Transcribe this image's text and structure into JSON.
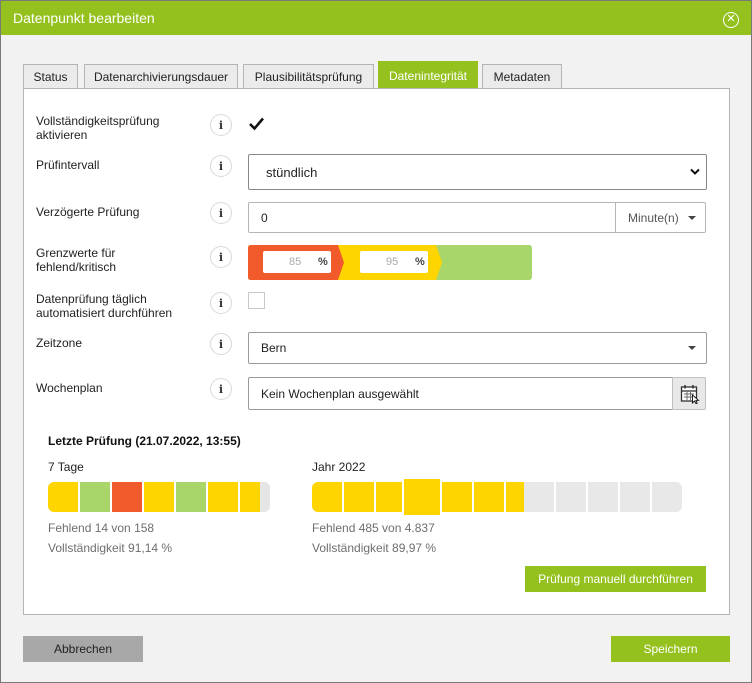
{
  "dialog": {
    "title": "Datenpunkt bearbeiten"
  },
  "tabs": [
    {
      "label": "Status"
    },
    {
      "label": "Datenarchivierungsdauer"
    },
    {
      "label": "Plausibilitätsprüfung"
    },
    {
      "label": "Datenintegrität",
      "active": true
    },
    {
      "label": "Metadaten"
    }
  ],
  "form": {
    "completeness": {
      "label_line1": "Vollständigkeitsprüfung",
      "label_line2": "aktivieren",
      "checked": true
    },
    "interval": {
      "label": "Prüfintervall",
      "value": "stündlich"
    },
    "delay": {
      "label": "Verzögerte Prüfung",
      "value": "0",
      "unit": "Minute(n)"
    },
    "thresholds": {
      "label_line1": "Grenzwerte für",
      "label_line2": "fehlend/kritisch",
      "missing": "85",
      "critical": "95",
      "unit": "%"
    },
    "daily": {
      "label_line1": "Datenprüfung täglich",
      "label_line2": "automatisiert durchführen",
      "checked": false
    },
    "timezone": {
      "label": "Zeitzone",
      "value": "Bern"
    },
    "weekplan": {
      "label": "Wochenplan",
      "value": "Kein Wochenplan ausgewählt"
    }
  },
  "last_check": {
    "title": "Letzte Prüfung (21.07.2022, 13:55)",
    "week": {
      "label": "7 Tage",
      "missing_text": "Fehlend 14 von 158",
      "completeness_text": "Vollständigkeit 91,14 %"
    },
    "year": {
      "label": "Jahr 2022",
      "missing_text": "Fehlend 485 von 4.837",
      "completeness_text": "Vollständigkeit 89,97 %"
    },
    "manual_button": "Prüfung manuell durchführen"
  },
  "footer": {
    "cancel": "Abbrechen",
    "save": "Speichern"
  },
  "colors": {
    "accent": "#95c11f",
    "ok": "#a8d66b",
    "warning": "#ffd500",
    "critical": "#f15a2b",
    "empty": "#e5e5e5"
  }
}
